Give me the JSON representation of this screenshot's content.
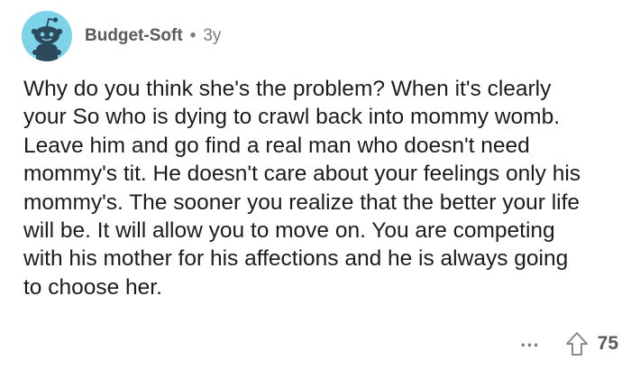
{
  "comment": {
    "author": "Budget-Soft",
    "separator": "•",
    "age": "3y",
    "body": "Why do you think she's the problem? When it's clearly your So who is dying to crawl back into mommy womb. Leave him and go find a real man who doesn't need mommy's tit. He doesn't care about your feelings only his mommy's. The sooner you realize that the better your life will be. It will allow you to move on. You are competing with his mother for his affections and he is always going to choose her.",
    "more_label": "...",
    "score": "75"
  },
  "icons": {
    "avatar": "reddit-snoo-avatar-icon",
    "upvote": "upvote-arrow-icon"
  },
  "colors": {
    "avatar_bg": "#7dd3e8",
    "avatar_figure": "#2c4a5c",
    "text": "#1c1c1c",
    "muted": "#7c7c7c",
    "background": "#ffffff"
  }
}
